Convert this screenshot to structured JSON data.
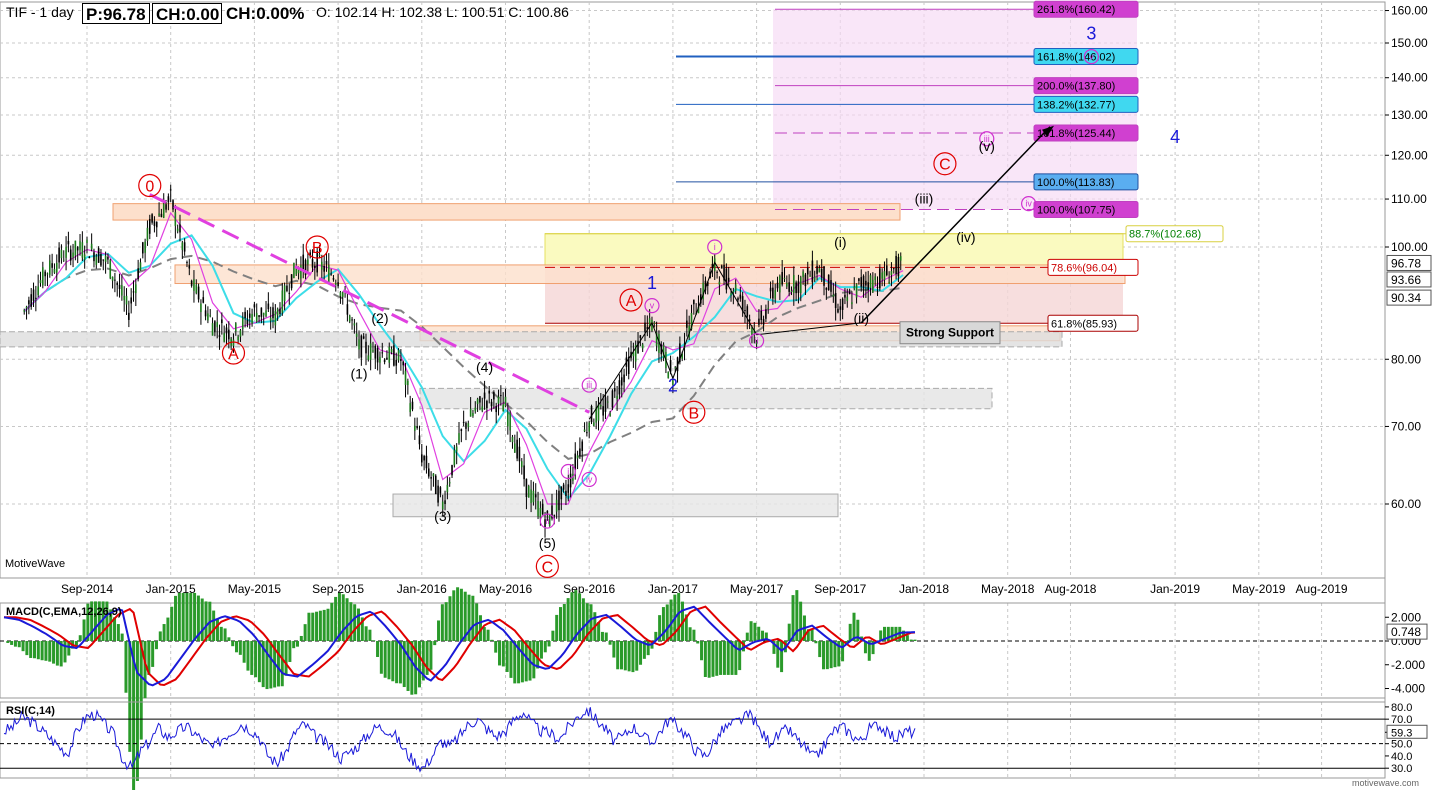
{
  "header": {
    "symbol": "TIF - 1 day",
    "price": "P:96.78",
    "change": "CH:0.00",
    "change_pct": "CH:0.00%",
    "ohlc": "O: 102.14  H: 102.38  L: 100.51  C: 100.86"
  },
  "watermark": "MotiveWave",
  "footer": "motivewave.com",
  "macd_title": "MACD(C,EMA,12,26,9)",
  "rsi_title": "RSI(C,14)",
  "colors": {
    "candle": "#000000",
    "ma_fast": "#e040e0",
    "ma_mid": "#3ddde8",
    "ma_slow": "#808080",
    "elliott_red": "#e00000",
    "elliott_blue": "#1a1ad8",
    "elliott_magenta": "#d030d0",
    "trend": "#e040e0",
    "macd_line": "#1a1ad8",
    "signal_line": "#e00000",
    "hist": "#2a9a2a"
  },
  "chart_data": {
    "type": "candlestick",
    "x_ticks": [
      "Sep-2014",
      "Jan-2015",
      "May-2015",
      "Sep-2015",
      "Jan-2016",
      "May-2016",
      "Sep-2016",
      "Jan-2017",
      "May-2017",
      "Sep-2017",
      "Jan-2018",
      "May-2018",
      "Aug-2018",
      "Jan-2019",
      "May-2019",
      "Aug-2019"
    ],
    "y_scale": "log",
    "y_ticks": [
      "160.00",
      "150.00",
      "140.00",
      "130.00",
      "120.00",
      "110.00",
      "100.00",
      "80.00",
      "70.00",
      "60.00"
    ],
    "ylim": [
      50,
      165
    ],
    "price_labels": [
      {
        "text": "96.78",
        "value": 96.78
      },
      {
        "text": "93.66",
        "value": 93.66
      },
      {
        "text": "90.34",
        "value": 90.34
      }
    ],
    "price_series": [
      {
        "date": "2014-06",
        "close": 88
      },
      {
        "date": "2014-07",
        "close": 95
      },
      {
        "date": "2014-08",
        "close": 99
      },
      {
        "date": "2014-09",
        "close": 100
      },
      {
        "date": "2014-10",
        "close": 97
      },
      {
        "date": "2014-11",
        "close": 88
      },
      {
        "date": "2014-12",
        "close": 104
      },
      {
        "date": "2015-01",
        "close": 110
      },
      {
        "date": "2015-02",
        "close": 93
      },
      {
        "date": "2015-03",
        "close": 86
      },
      {
        "date": "2015-04",
        "close": 84
      },
      {
        "date": "2015-05",
        "close": 88
      },
      {
        "date": "2015-06",
        "close": 87
      },
      {
        "date": "2015-07",
        "close": 96
      },
      {
        "date": "2015-08",
        "close": 97
      },
      {
        "date": "2015-09",
        "close": 94
      },
      {
        "date": "2015-10",
        "close": 82
      },
      {
        "date": "2015-11",
        "close": 81
      },
      {
        "date": "2015-12",
        "close": 80
      },
      {
        "date": "2016-01",
        "close": 66
      },
      {
        "date": "2016-02",
        "close": 60
      },
      {
        "date": "2016-03",
        "close": 70
      },
      {
        "date": "2016-04",
        "close": 74
      },
      {
        "date": "2016-05",
        "close": 73
      },
      {
        "date": "2016-06",
        "close": 62
      },
      {
        "date": "2016-07",
        "close": 58
      },
      {
        "date": "2016-08",
        "close": 62
      },
      {
        "date": "2016-09",
        "close": 71
      },
      {
        "date": "2016-10",
        "close": 73
      },
      {
        "date": "2016-11",
        "close": 80
      },
      {
        "date": "2016-12",
        "close": 86
      },
      {
        "date": "2017-01",
        "close": 77
      },
      {
        "date": "2017-02",
        "close": 88
      },
      {
        "date": "2017-03",
        "close": 96
      },
      {
        "date": "2017-04",
        "close": 92
      },
      {
        "date": "2017-05",
        "close": 84
      },
      {
        "date": "2017-06",
        "close": 93
      },
      {
        "date": "2017-07",
        "close": 93
      },
      {
        "date": "2017-08",
        "close": 96
      },
      {
        "date": "2017-09",
        "close": 88
      },
      {
        "date": "2017-10",
        "close": 93
      },
      {
        "date": "2017-11",
        "close": 94
      },
      {
        "date": "2017-12",
        "close": 96.78
      }
    ],
    "fib_levels": [
      {
        "text": "261.8%(160.42)",
        "value": 160.42,
        "style": "magenta"
      },
      {
        "text": "161.8%(146.02)",
        "value": 146.02,
        "style": "cyan"
      },
      {
        "text": "200.0%(137.80)",
        "value": 137.8,
        "style": "magenta"
      },
      {
        "text": "138.2%(132.77)",
        "value": 132.77,
        "style": "cyan"
      },
      {
        "text": "161.8%(125.44)",
        "value": 125.44,
        "style": "magenta"
      },
      {
        "text": "100.0%(113.83)",
        "value": 113.83,
        "style": "blue"
      },
      {
        "text": "100.0%(107.75)",
        "value": 107.75,
        "style": "magenta"
      },
      {
        "text": "88.7%(102.68)",
        "value": 102.68,
        "style": "yellow"
      },
      {
        "text": "78.6%(96.04)",
        "value": 96.04,
        "style": "red"
      },
      {
        "text": "61.8%(85.93)",
        "value": 85.93,
        "style": "plain"
      }
    ],
    "annotations": [
      {
        "label": "0",
        "kind": "circle",
        "color": "red",
        "date": "2014-12",
        "value": 113
      },
      {
        "label": "A",
        "kind": "circle",
        "color": "red",
        "date": "2015-04",
        "value": 81
      },
      {
        "label": "B",
        "kind": "circle",
        "color": "red",
        "date": "2015-08",
        "value": 100
      },
      {
        "label": "(1)",
        "kind": "text",
        "date": "2015-10",
        "value": 77
      },
      {
        "label": "(2)",
        "kind": "text",
        "date": "2015-11",
        "value": 86
      },
      {
        "label": "(3)",
        "kind": "text",
        "date": "2016-02",
        "value": 58
      },
      {
        "label": "(4)",
        "kind": "text",
        "date": "2016-04",
        "value": 78
      },
      {
        "label": "(5)",
        "kind": "text",
        "date": "2016-07",
        "value": 55
      },
      {
        "label": "C",
        "kind": "circle",
        "color": "red",
        "date": "2016-07",
        "value": 53
      },
      {
        "label": "A",
        "kind": "circle",
        "color": "red",
        "date": "2016-11",
        "value": 90
      },
      {
        "label": "1",
        "kind": "text",
        "color": "blue",
        "date": "2016-12",
        "value": 92
      },
      {
        "label": "2",
        "kind": "text",
        "color": "blue",
        "date": "2017-01",
        "value": 75
      },
      {
        "label": "B",
        "kind": "circle",
        "color": "red",
        "date": "2017-02",
        "value": 72
      },
      {
        "label": "i",
        "kind": "circle",
        "color": "magenta",
        "date": "2016-08",
        "value": 64
      },
      {
        "label": "ii",
        "kind": "circle",
        "color": "magenta",
        "date": "2016-07",
        "value": 58
      },
      {
        "label": "iii",
        "kind": "circle",
        "color": "magenta",
        "date": "2016-09",
        "value": 76
      },
      {
        "label": "iv",
        "kind": "circle",
        "color": "magenta",
        "date": "2016-09",
        "value": 63
      },
      {
        "label": "v",
        "kind": "circle",
        "color": "magenta",
        "date": "2016-12",
        "value": 89
      },
      {
        "label": "i",
        "kind": "circle",
        "color": "magenta",
        "date": "2017-03",
        "value": 100
      },
      {
        "label": "ii",
        "kind": "circle",
        "color": "magenta",
        "date": "2017-05",
        "value": 83
      },
      {
        "label": "(i)",
        "kind": "text",
        "date": "2017-09",
        "value": 100
      },
      {
        "label": "(ii)",
        "kind": "text",
        "date": "2017-10",
        "value": 86
      },
      {
        "label": "iii",
        "kind": "circle",
        "color": "magenta",
        "date": "2018-04",
        "value": 124
      },
      {
        "label": "(v)",
        "kind": "text",
        "date": "2018-04",
        "value": 121
      },
      {
        "label": "(iii)",
        "kind": "text",
        "date": "2018-01",
        "value": 109
      },
      {
        "label": "(iv)",
        "kind": "text",
        "date": "2018-03",
        "value": 101
      },
      {
        "label": "iv",
        "kind": "circle",
        "color": "magenta",
        "date": "2018-06",
        "value": 109
      },
      {
        "label": "C",
        "kind": "circle",
        "color": "red",
        "date": "2018-02",
        "value": 118
      },
      {
        "label": "3",
        "kind": "text",
        "color": "blue",
        "date": "2018-09",
        "value": 151
      },
      {
        "label": "v",
        "kind": "circle",
        "color": "magenta",
        "date": "2018-09",
        "value": 146
      },
      {
        "label": "4",
        "kind": "text",
        "color": "blue",
        "date": "2019-01",
        "value": 123
      }
    ],
    "support_label": "Strong Support",
    "macd": {
      "axis_ticks": [
        "2.000",
        "0.000",
        "-2.000",
        "-4.000"
      ],
      "current_value": "0.748",
      "ylim": [
        -4.8,
        3.2
      ],
      "values": [
        2.0,
        1.8,
        1.2,
        0.5,
        -0.4,
        -0.6,
        0.8,
        2.2,
        2.8,
        -2.6,
        -3.8,
        -3.2,
        -1.5,
        0.2,
        1.6,
        2.1,
        1.7,
        0.5,
        -1.2,
        -2.8,
        -3.0,
        -2.0,
        -0.9,
        0.8,
        2.1,
        2.5,
        1.2,
        -0.3,
        -2.2,
        -3.4,
        -2.1,
        -0.2,
        1.4,
        1.8,
        0.9,
        -0.6,
        -2.0,
        -2.4,
        -1.2,
        0.6,
        1.9,
        2.2,
        1.2,
        0.1,
        -0.4,
        0.8,
        2.5,
        2.9,
        1.6,
        0.4,
        -0.8,
        -0.1,
        0.2,
        -0.9,
        0.9,
        1.3,
        0.3,
        -0.6,
        0.4,
        -0.3,
        0.2,
        0.7,
        0.748
      ]
    },
    "rsi": {
      "axis_ticks": [
        "80.0",
        "70.0",
        "59.3",
        "50.0",
        "40.0",
        "30.0"
      ],
      "current_value": "59.3",
      "ylim": [
        22,
        84
      ],
      "levels": [
        70,
        50,
        30
      ],
      "values": [
        60,
        64,
        72,
        68,
        62,
        55,
        48,
        42,
        60,
        72,
        74,
        66,
        58,
        38,
        30,
        44,
        52,
        63,
        55,
        60,
        64,
        58,
        52,
        46,
        55,
        60,
        66,
        62,
        56,
        40,
        34,
        44,
        60,
        66,
        57,
        52,
        46,
        38,
        44,
        49,
        58,
        64,
        62,
        56,
        44,
        36,
        30,
        40,
        52,
        48,
        56,
        66,
        70,
        62,
        56,
        60,
        70,
        76,
        66,
        60,
        58,
        54,
        64,
        72,
        78,
        70,
        62,
        52,
        56,
        64,
        58,
        50,
        60,
        70,
        64,
        56,
        44,
        40,
        52,
        62,
        66,
        70,
        74,
        60,
        52,
        56,
        62,
        54,
        46,
        38,
        48,
        60,
        64,
        58,
        52,
        62,
        66,
        58,
        55,
        60,
        59.3
      ]
    }
  }
}
